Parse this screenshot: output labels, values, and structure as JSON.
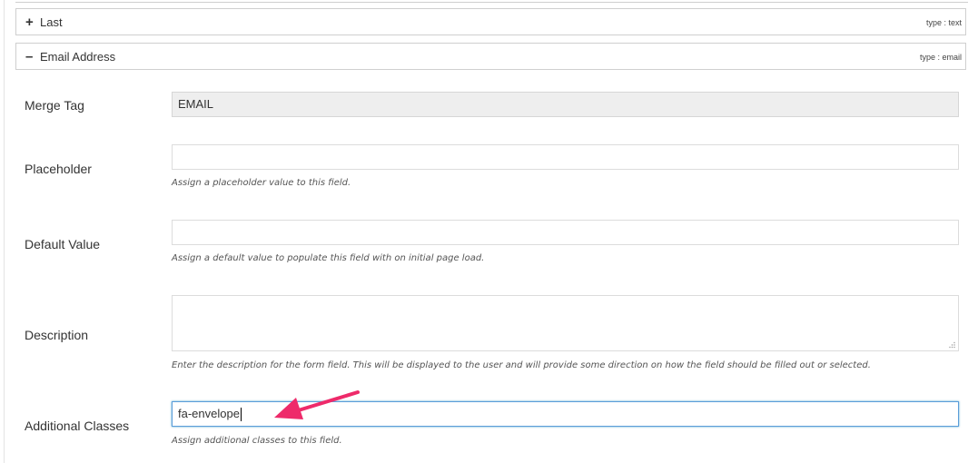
{
  "fields": [
    {
      "toggle": "+",
      "name": "Last",
      "type": "type : text"
    },
    {
      "toggle": "–",
      "name": "Email Address",
      "type": "type : email"
    }
  ],
  "settings": {
    "merge_tag": {
      "label": "Merge Tag",
      "value": "EMAIL"
    },
    "placeholder": {
      "label": "Placeholder",
      "value": "",
      "help": "Assign a placeholder value to this field."
    },
    "default_value": {
      "label": "Default Value",
      "value": "",
      "help": "Assign a default value to populate this field with on initial page load."
    },
    "description": {
      "label": "Description",
      "value": "",
      "help": "Enter the description for the form field. This will be displayed to the user and will provide some direction on how the field should be filled out or selected."
    },
    "additional_classes": {
      "label": "Additional Classes",
      "value": "fa-envelope",
      "help": "Assign additional classes to this field."
    }
  },
  "colors": {
    "annotation_arrow": "#ee2a6a",
    "focus_border": "#5b9dd9"
  }
}
